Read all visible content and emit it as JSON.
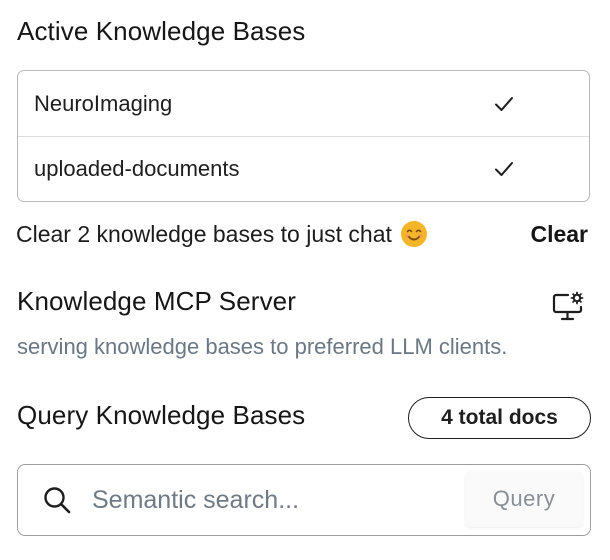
{
  "active": {
    "title": "Active Knowledge Bases",
    "items": [
      {
        "label": "NeuroImaging"
      },
      {
        "label": "uploaded-documents"
      }
    ]
  },
  "clear": {
    "text": "Clear 2 knowledge bases to just chat",
    "emoji": "😊",
    "button_label": "Clear"
  },
  "mcp": {
    "title": "Knowledge MCP Server",
    "subtitle": "serving knowledge bases to preferred LLM clients.",
    "icon": "monitor-settings-icon"
  },
  "query": {
    "title": "Query Knowledge Bases",
    "docs_badge": "4 total docs",
    "search_placeholder": "Semantic search...",
    "button_label": "Query"
  },
  "colors": {
    "text": "#161616",
    "muted": "#6a7784",
    "border": "#b9b9b9",
    "emoji": "#f5b529"
  }
}
